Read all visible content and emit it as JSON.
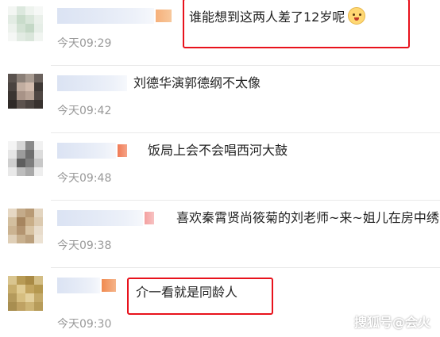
{
  "comments": [
    {
      "text": "谁能想到这两人差了12岁呢",
      "time": "今天09:29",
      "emoji": "smiling-face-emoji"
    },
    {
      "text": "刘德华演郭德纲不太像",
      "time": "今天09:42"
    },
    {
      "text": "饭局上会不会唱西河大鼓",
      "time": "今天09:48"
    },
    {
      "text": "喜欢秦霄贤尚筱菊的刘老师~来~姐儿在房中绣",
      "time": "今天09:38"
    },
    {
      "text": "介一看就是同龄人",
      "time": "今天09:30"
    }
  ],
  "watermark": "搜狐号@会火",
  "colors": {
    "highlight": "#e8121c",
    "timestamp": "#999999",
    "text": "#222222"
  }
}
